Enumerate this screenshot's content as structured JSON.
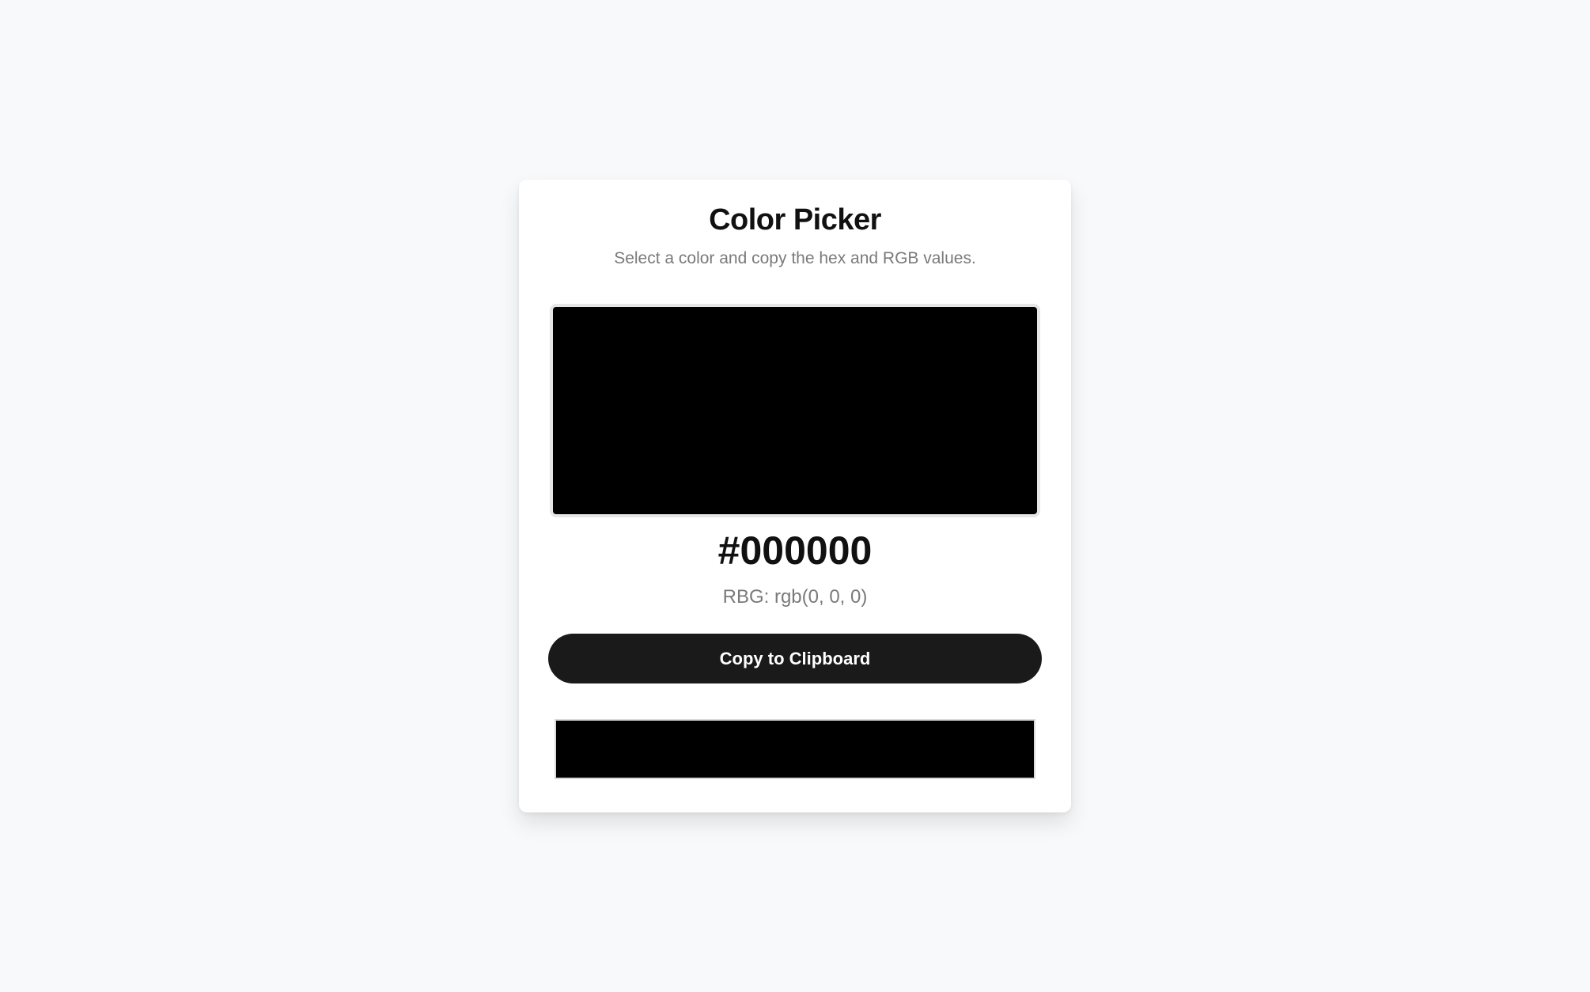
{
  "header": {
    "title": "Color Picker",
    "subtitle": "Select a color and copy the hex and RGB values."
  },
  "color": {
    "hex": "#000000",
    "rgb_text": "RBG: rgb(0, 0, 0)",
    "swatch_color": "#000000"
  },
  "actions": {
    "copy_label": "Copy to Clipboard"
  },
  "colors": {
    "page_background": "#f8f9fa",
    "card_background": "#ffffff",
    "button_background": "#1a1a1a"
  }
}
